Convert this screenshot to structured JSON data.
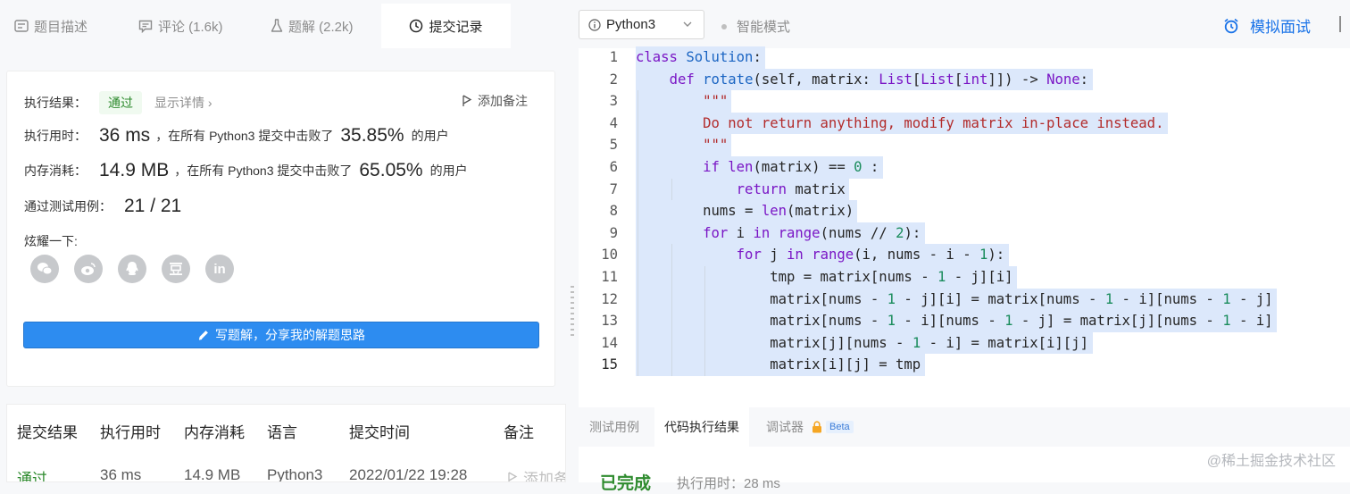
{
  "left_tabs": [
    {
      "label": "题目描述",
      "icon": "description-icon"
    },
    {
      "label": "评论 (1.6k)",
      "icon": "comment-icon"
    },
    {
      "label": "题解 (2.2k)",
      "icon": "flask-icon"
    },
    {
      "label": "提交记录",
      "icon": "clock-icon",
      "active": true
    }
  ],
  "result_card": {
    "exec_result_label": "执行结果：",
    "status": "通过",
    "show_detail": "显示详情 ›",
    "add_note": "添加备注",
    "time_label": "执行用时：",
    "time_value": "36 ms",
    "time_text": "，在所有 Python3 提交中击败了",
    "time_pct": "35.85%",
    "users_text": "的用户",
    "mem_label": "内存消耗：",
    "mem_value": "14.9 MB",
    "mem_text": "，在所有 Python3 提交中击败了",
    "mem_pct": "65.05%",
    "tests_label": "通过测试用例：",
    "tests_value": "21 / 21",
    "share_label": "炫耀一下:",
    "share_icons": [
      "wechat-icon",
      "weibo-icon",
      "qq-icon",
      "douban-icon",
      "linkedin-icon"
    ],
    "write_button": "写题解，分享我的解题思路"
  },
  "submissions_table": {
    "headers": [
      "提交结果",
      "执行用时",
      "内存消耗",
      "语言",
      "提交时间",
      "备注"
    ],
    "rows": [
      {
        "result": "通过",
        "time": "36 ms",
        "memory": "14.9 MB",
        "language": "Python3",
        "submitted": "2022/01/22 19:28",
        "note": "添加备注"
      }
    ]
  },
  "editor_toolbar": {
    "language": "Python3",
    "smart_mode": "智能模式",
    "mock_interview": "模拟面试"
  },
  "code_lines": [
    "class Solution:",
    "    def rotate(self, matrix: List[List[int]]) -> None:",
    "        \"\"\"",
    "        Do not return anything, modify matrix in-place instead.",
    "        \"\"\"",
    "        if len(matrix) == 0 :",
    "            return matrix",
    "        nums = len(matrix)",
    "        for i in range(nums // 2):",
    "            for j in range(i, nums - i - 1):",
    "                tmp = matrix[nums - 1 - j][i]",
    "                matrix[nums - 1 - j][i] = matrix[nums - 1 - i][nums - 1 - j]",
    "                matrix[nums - 1 - i][nums - 1 - j] = matrix[j][nums - 1 - i]",
    "                matrix[j][nums - 1 - i] = matrix[i][j]",
    "                matrix[i][j] = tmp"
  ],
  "bottom_tabs": [
    {
      "label": "测试用例"
    },
    {
      "label": "代码执行结果",
      "active": true
    },
    {
      "label": "调试器",
      "badge": "Beta",
      "icon": "lock-icon"
    }
  ],
  "result_panel": {
    "status": "已完成",
    "exec_time": "执行用时：28 ms"
  },
  "watermark": "@稀土掘金技术社区",
  "colors": {
    "accent_blue": "#2d8cf0",
    "pass_green": "#2e8b2e",
    "selection": "#dce8fb"
  }
}
